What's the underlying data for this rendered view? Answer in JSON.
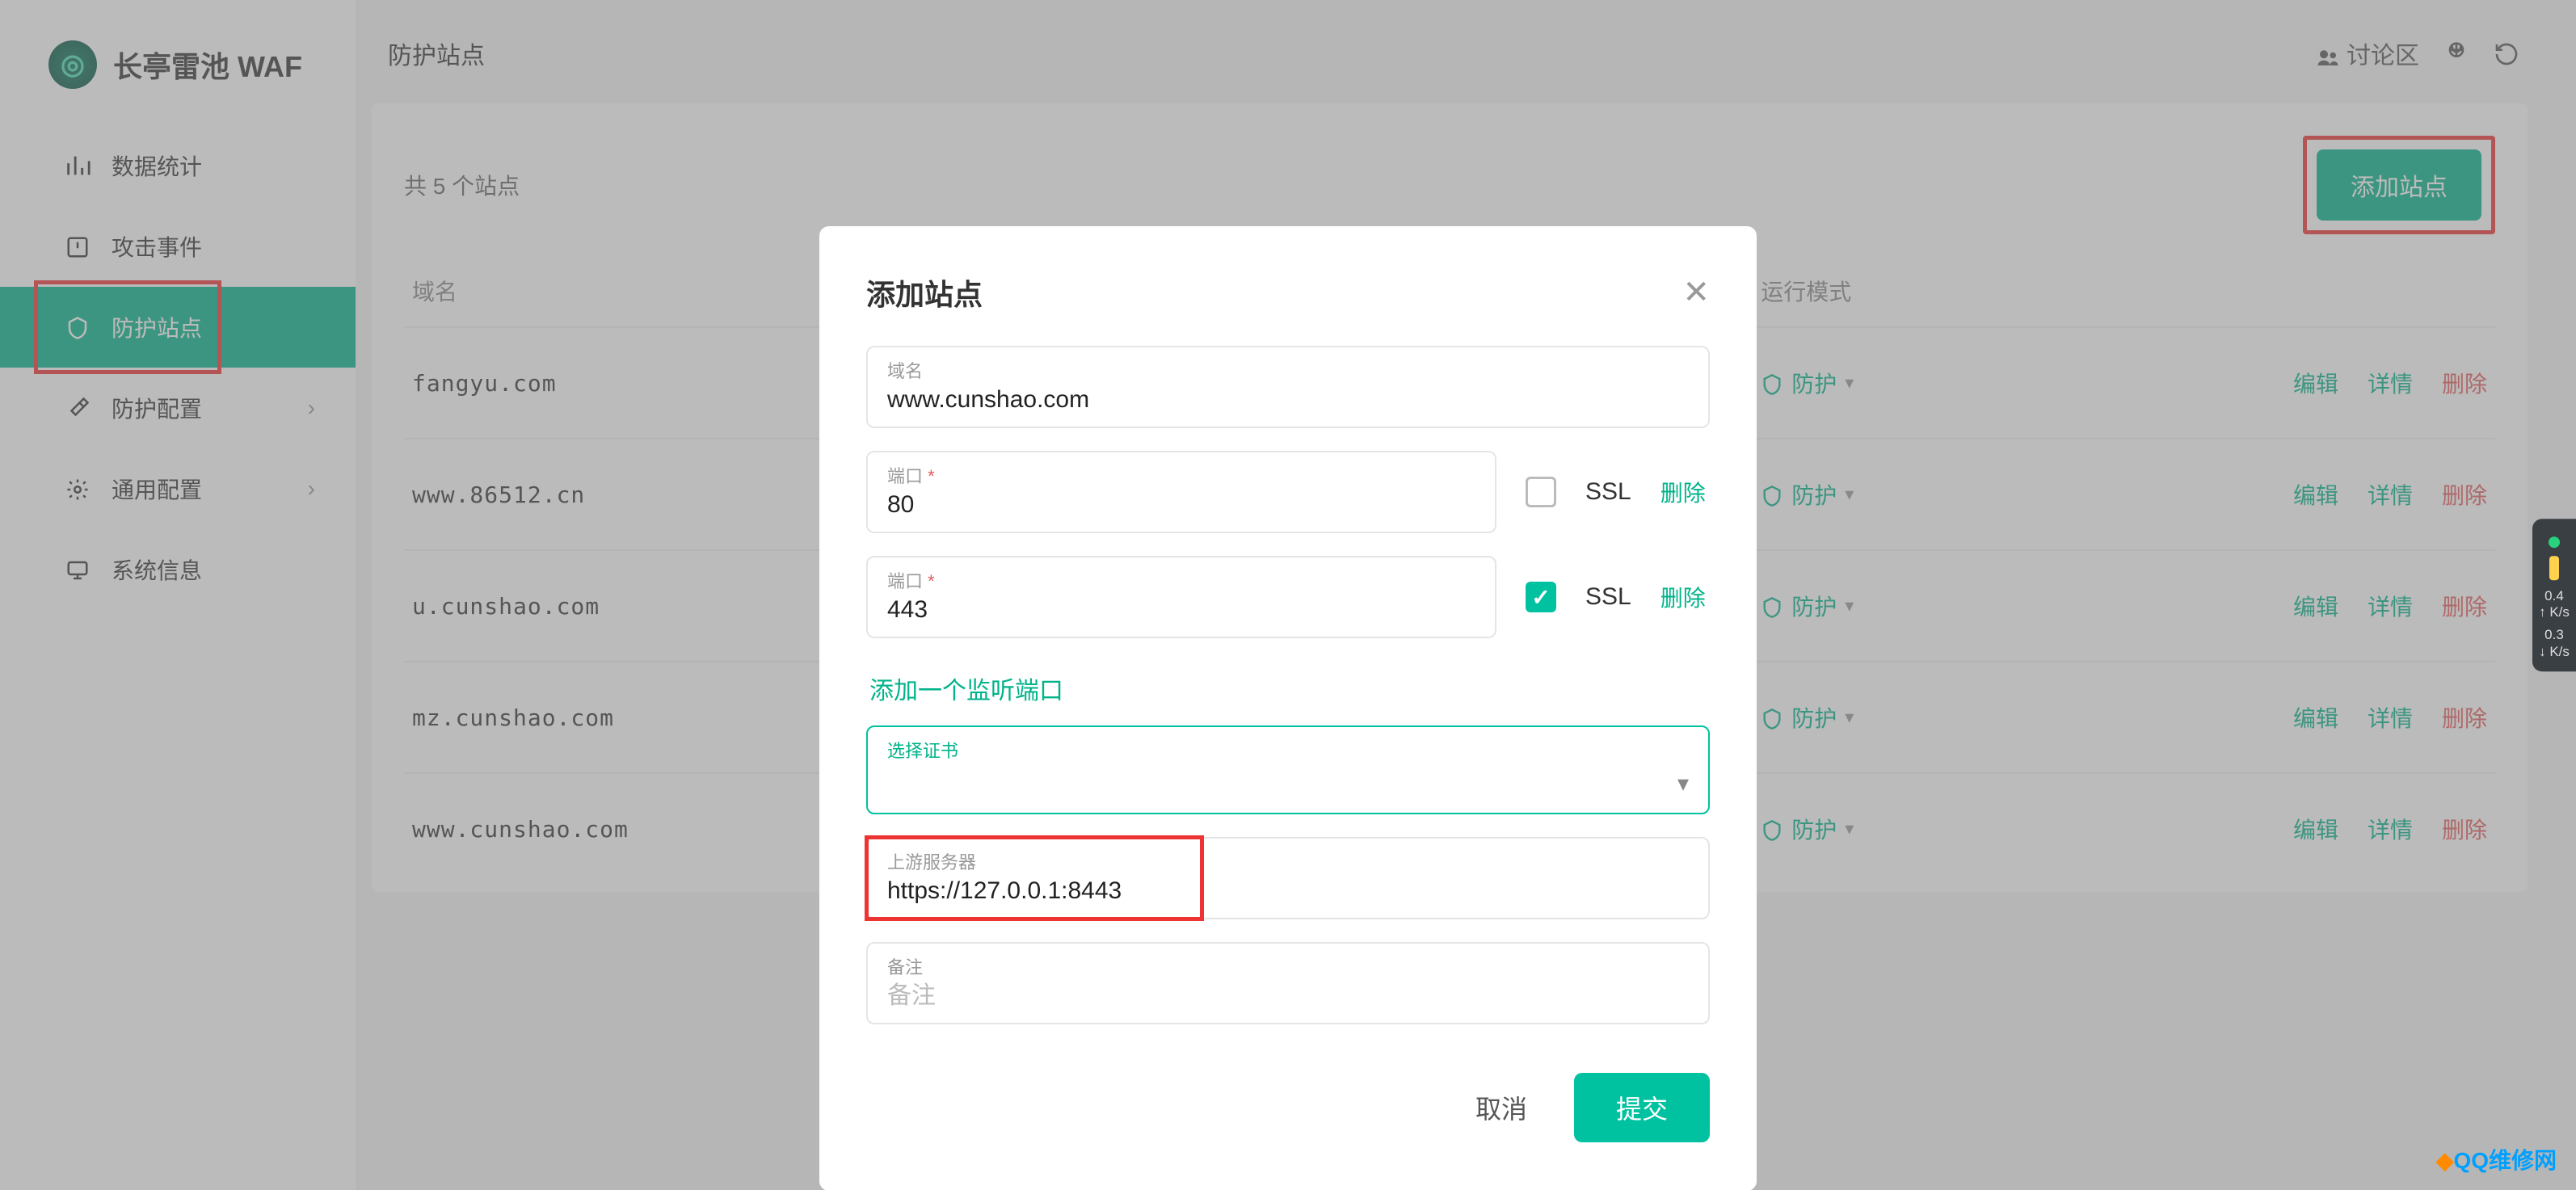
{
  "brand": "长亭雷池 WAF",
  "nav": {
    "stats": "数据统计",
    "attack": "攻击事件",
    "site": "防护站点",
    "protect": "防护配置",
    "general": "通用配置",
    "system": "系统信息"
  },
  "header": {
    "page_title": "防护站点",
    "forum": "讨论区",
    "lang": "EN"
  },
  "card": {
    "count_label": "共 5 个站点",
    "add_btn": "添加站点",
    "col_domain": "域名",
    "col_mode": "运行模式"
  },
  "rows": [
    {
      "domain": "fangyu.com",
      "mode": "防护",
      "edit": "编辑",
      "detail": "详情",
      "del": "删除"
    },
    {
      "domain": "www.86512.cn",
      "mode": "防护",
      "edit": "编辑",
      "detail": "详情",
      "del": "删除"
    },
    {
      "domain": "u.cunshao.com",
      "mode": "防护",
      "edit": "编辑",
      "detail": "详情",
      "del": "删除"
    },
    {
      "domain": "mz.cunshao.com",
      "mode": "防护",
      "edit": "编辑",
      "detail": "详情",
      "del": "删除"
    },
    {
      "domain": "www.cunshao.com",
      "mode": "防护",
      "edit": "编辑",
      "detail": "详情",
      "del": "删除"
    }
  ],
  "modal": {
    "title": "添加站点",
    "domain_label": "域名",
    "domain_value": "www.cunshao.com",
    "port_label": "端口",
    "port1_value": "80",
    "port2_value": "443",
    "ssl_label": "SSL",
    "del_port": "删除",
    "add_port": "添加一个监听端口",
    "cert_label": "选择证书",
    "upstream_label": "上游服务器",
    "upstream_value": "https://127.0.0.1:8443",
    "remark_label": "备注",
    "remark_placeholder": "备注",
    "cancel": "取消",
    "submit": "提交"
  },
  "widget": {
    "v1": "0.4",
    "u1": "K/s",
    "v2": "0.3",
    "u2": "K/s"
  },
  "watermark": "QQ维修网"
}
